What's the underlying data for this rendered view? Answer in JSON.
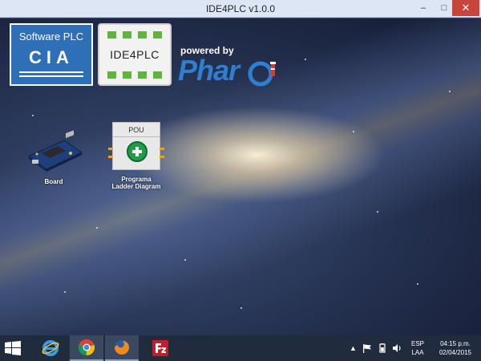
{
  "window": {
    "title": "IDE4PLC v1.0.0",
    "controls": {
      "minimize": "–",
      "maximize": "□",
      "close": "✕"
    }
  },
  "logos": {
    "cia": {
      "line1": "Software PLC",
      "line2": "CIA"
    },
    "ide4plc": {
      "label": "IDE4PLC"
    },
    "pharo": {
      "powered_by": "powered by",
      "name": "Phar"
    }
  },
  "desktop_icons": [
    {
      "id": "board",
      "label": "Board",
      "icon": "board-icon"
    },
    {
      "id": "pou",
      "label": "Programa\nLadder Diagram",
      "icon": "pou-icon",
      "header": "POU"
    }
  ],
  "taskbar": {
    "apps": [
      {
        "name": "Internet Explorer",
        "icon": "internet-explorer-icon"
      },
      {
        "name": "Chrome",
        "icon": "chrome-icon"
      },
      {
        "name": "Firefox",
        "icon": "firefox-icon"
      },
      {
        "name": "FileZilla",
        "icon": "filezilla-icon"
      }
    ],
    "tray": {
      "language": "ESP",
      "layout": "LAA",
      "time": "04:15 p.m.",
      "date": "02/04/2015"
    }
  },
  "colors": {
    "cia_blue": "#2f6fb7",
    "pharo_blue": "#2e7fd0",
    "ide_green": "#5fb43b",
    "close_red": "#c7453a",
    "taskbar": "#202c3e"
  }
}
